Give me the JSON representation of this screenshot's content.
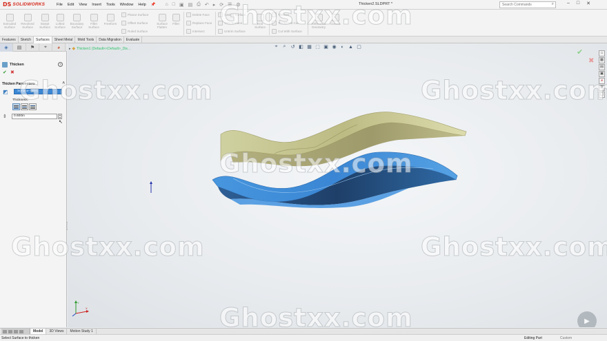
{
  "app": {
    "brand": "SOLIDWORKS",
    "brand_mark": "DS",
    "menus": [
      "File",
      "Edit",
      "View",
      "Insert",
      "Tools",
      "Window",
      "Help"
    ],
    "document_title": "Thicken2.SLDPRT *",
    "search_placeholder": "Search Commands"
  },
  "ribbon": {
    "large": [
      {
        "label1": "Extruded",
        "label2": "Surface"
      },
      {
        "label1": "Revolved",
        "label2": "Surface"
      },
      {
        "label1": "Swept",
        "label2": "Surface"
      },
      {
        "label1": "Lofted",
        "label2": "Surface"
      },
      {
        "label1": "Boundary",
        "label2": "Surface"
      },
      {
        "label1": "Fillet",
        "label2": "Surface"
      },
      {
        "label1": "Freeform",
        "label2": ""
      }
    ],
    "col1": [
      "Planar Surface",
      "Offset Surface",
      "Ruled Surface"
    ],
    "flatten": {
      "label1": "Surface",
      "label2": "Flatten"
    },
    "fillet": {
      "label1": "Fillet",
      "label2": ""
    },
    "col2": [
      "Delete Face",
      "Replace Face",
      "Intersect"
    ],
    "col3": [
      "Extend Surface",
      "Trim Surface",
      "Untrim Surface"
    ],
    "knit": {
      "label1": "Knit",
      "label2": "Surface"
    },
    "col4": [
      "Thicken",
      "Thickened Cut",
      "Cut With Surface"
    ],
    "refgeom": {
      "label1": "Reference",
      "label2": "Geometry"
    },
    "curves": {
      "label1": "Curves",
      "label2": ""
    }
  },
  "tabs": [
    "Features",
    "Sketch",
    "Surfaces",
    "Sheet Metal",
    "Mold Tools",
    "Data Migration",
    "Evaluate"
  ],
  "property_manager": {
    "title": "Thicken",
    "group": "Thicken Parameters",
    "surface_value": "Surface-Trim1",
    "thickness_label": "Thickness:",
    "thickness_value": "0.600in"
  },
  "viewport": {
    "tree_item": "Thicken1 (Default<<Default>_Dis..."
  },
  "watermark": "Ghostxx.com",
  "bottom_tabs": [
    "Model",
    "3D Views",
    "Motion Study 1"
  ],
  "status": {
    "message": "Select Surface to thicken",
    "mode": "Editing Part",
    "units": "Custom"
  },
  "colors": {
    "brand_red": "#d52b1e",
    "top_surface": "#d2d49e",
    "bottom_surface": "#3e8ed9",
    "selection": "#3a86d4",
    "tree_green": "#33c26a"
  }
}
